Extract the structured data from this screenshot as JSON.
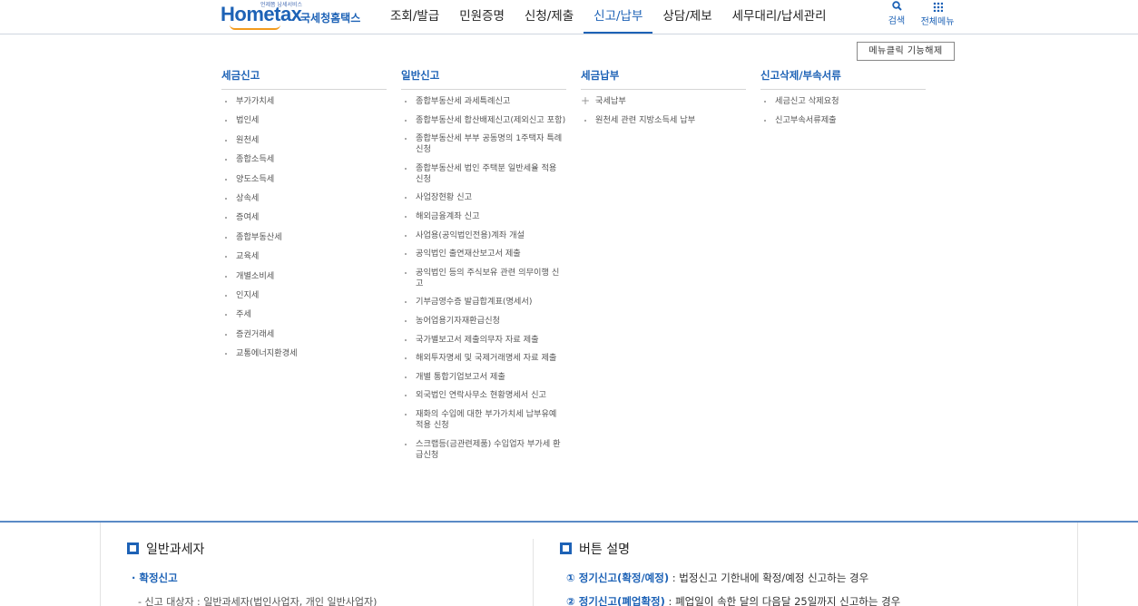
{
  "header": {
    "logo_tag": "언제쯤 납세서비스",
    "logo_text": "Hometax",
    "logo_name": "국세청홈택스",
    "nav": [
      {
        "label": "조회/발급"
      },
      {
        "label": "민원증명"
      },
      {
        "label": "신청/제출"
      },
      {
        "label": "신고/납부",
        "active": true
      },
      {
        "label": "상담/제보"
      },
      {
        "label": "세무대리/납세관리"
      }
    ],
    "search_label": "검색",
    "allmenu_label": "전체메뉴"
  },
  "menu": {
    "fix_button": "메뉴클릭 기능해제",
    "columns": [
      {
        "title": "세금신고",
        "items": [
          "부가가치세",
          "법인세",
          "원천세",
          "종합소득세",
          "양도소득세",
          "상속세",
          "증여세",
          "종합부동산세",
          "교육세",
          "개별소비세",
          "인지세",
          "주세",
          "증권거래세",
          "교통에너지환경세"
        ]
      },
      {
        "title": "일반신고",
        "items": [
          "종합부동산세 과세특례신고",
          "종합부동산세 합산배제신고(제외신고 포함)",
          "종합부동산세 부부 공동명의 1주택자 특례 신청",
          "종합부동산세 법인 주택분 일반세율 적용 신청",
          "사업장현황 신고",
          "해외금융계좌 신고",
          "사업용(공익법인전용)계좌 개설",
          "공익법인 출연재산보고서 제출",
          "공익법인 등의 주식보유 관련 의무이행 신고",
          "기부금영수증 발급합계표(명세서)",
          "농어업용기자재환급신청",
          "국가별보고서 제출의무자 자료 제출",
          "해외투자명세 및 국제거래명세 자료 제출",
          "개별 통합기업보고서 제출",
          "외국법인 연락사무소 현황명세서 신고",
          "재화의 수입에 대한 부가가치세 납부유예 적용 신청",
          "스크랩등(금관련제품) 수입업자 부가세 환급신청"
        ]
      },
      {
        "title": "세금납부",
        "items": [
          "국세납부",
          "원천세 관련 지방소득세 납부"
        ]
      },
      {
        "title": "신고삭제/부속서류",
        "items": [
          "세금신고 삭제요청",
          "신고부속서류제출"
        ]
      }
    ]
  },
  "content": {
    "left_title": "일반과세자",
    "sub_head": "· 확정신고",
    "sub_item": "- 신고 대상자 : 일반과세자(법인사업자, 개인 일반사업자)",
    "right_title": "버튼 설명",
    "desc1_label": "① 정기신고(확정/예정)",
    "desc1_text": " : 법정신고 기한내에 확정/예정 신고하는 경우",
    "desc2_label": "② 정기신고(폐업확정)",
    "desc2_text": " : 폐업일이 속한 달의 다음달 25일까지 신고하는 경우"
  },
  "colors": {
    "accent": "#1d62b6",
    "swoosh": "#f29b1d"
  }
}
